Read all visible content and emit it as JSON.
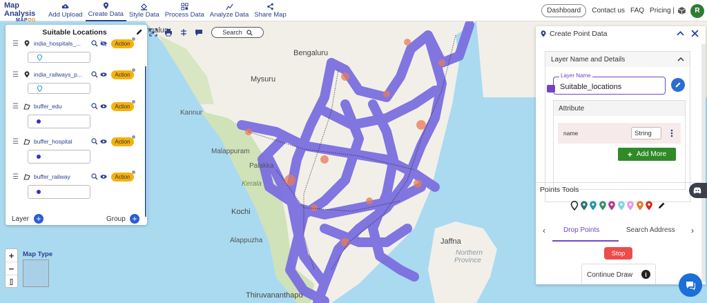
{
  "app": {
    "logo_title": "Map Analysis",
    "logo_sub_a": "MAP",
    "logo_sub_b": "OG"
  },
  "nav": {
    "items": [
      {
        "label": "Add Upload",
        "icon": "cloud-upload-icon"
      },
      {
        "label": "Create Data",
        "icon": "map-pin-icon",
        "active": true
      },
      {
        "label": "Style Data",
        "icon": "paint-bucket-icon"
      },
      {
        "label": "Process Data",
        "icon": "process-grid-icon"
      },
      {
        "label": "Analyze Data",
        "icon": "analyze-chart-icon"
      },
      {
        "label": "Share Map",
        "icon": "share-icon"
      }
    ]
  },
  "topright": {
    "dashboard": "Dashboard",
    "contact": "Contact us",
    "faq": "FAQ",
    "pricing": "Pricing |",
    "avatar_initial": "R"
  },
  "map_tools": {
    "search_label": "Search"
  },
  "left_panel": {
    "title": "Suitable Locations",
    "layers": [
      {
        "name": "india_hospitals_...",
        "type": "point",
        "legend": "pin",
        "action": "Action",
        "visible": false
      },
      {
        "name": "india_railways_p...",
        "type": "point",
        "legend": "pin",
        "action": "Action",
        "visible": true
      },
      {
        "name": "buffer_edu",
        "type": "polygon",
        "legend": "dot",
        "action": "Action",
        "visible": true
      },
      {
        "name": "buffer_hospital",
        "type": "polygon",
        "legend": "dot",
        "action": "Action",
        "visible": true
      },
      {
        "name": "buffer_railway",
        "type": "polygon",
        "legend": "dot",
        "action": "Action",
        "visible": true
      }
    ],
    "layer_label": "Layer",
    "group_label": "Group"
  },
  "map_labels": [
    {
      "text": "ngaluru",
      "cls": "big"
    },
    {
      "text": "Bengaluru",
      "cls": "big"
    },
    {
      "text": "Mysuru",
      "cls": "big"
    },
    {
      "text": "Kannur",
      "cls": ""
    },
    {
      "text": "Malappuram",
      "cls": ""
    },
    {
      "text": "Palakka",
      "cls": ""
    },
    {
      "text": "Kerala",
      "cls": "green"
    },
    {
      "text": "Kochi",
      "cls": "big"
    },
    {
      "text": "Alappuzha",
      "cls": ""
    },
    {
      "text": "Thiruvananthapu",
      "cls": "big"
    },
    {
      "text": "Jaffna",
      "cls": "big"
    },
    {
      "text": "Northern",
      "cls": "gray"
    },
    {
      "text": "Province",
      "cls": "gray"
    }
  ],
  "map_type": {
    "label": "Map Type"
  },
  "colors": {
    "buffer": "#7b6fe0",
    "accent_purple": "#6f46c2",
    "action": "#f5b10f",
    "add_more": "#2f8a27",
    "stop": "#ee4b4b",
    "nav_blue": "#2a3f8f"
  },
  "right_panel": {
    "title": "Create Point Data",
    "section_title": "Layer Name and Details",
    "layer_name_label": "Layer Name",
    "layer_name_value": "Suitable_locations",
    "attribute_title": "Attribute",
    "attribute_name": "name",
    "attribute_type": "String",
    "add_more": "Add More",
    "points_tools_title": "Points Tools",
    "point_colors": [
      "#222222",
      "#2e6f7a",
      "#1e98b0",
      "#3a8f6e",
      "#b23a8a",
      "#7fd3e0",
      "#e79be0",
      "#e27a2a",
      "#d0311e"
    ],
    "tabs": [
      "Drop Points",
      "Search Address"
    ],
    "stop": "Stop",
    "continue_draw": "Continue Draw"
  }
}
